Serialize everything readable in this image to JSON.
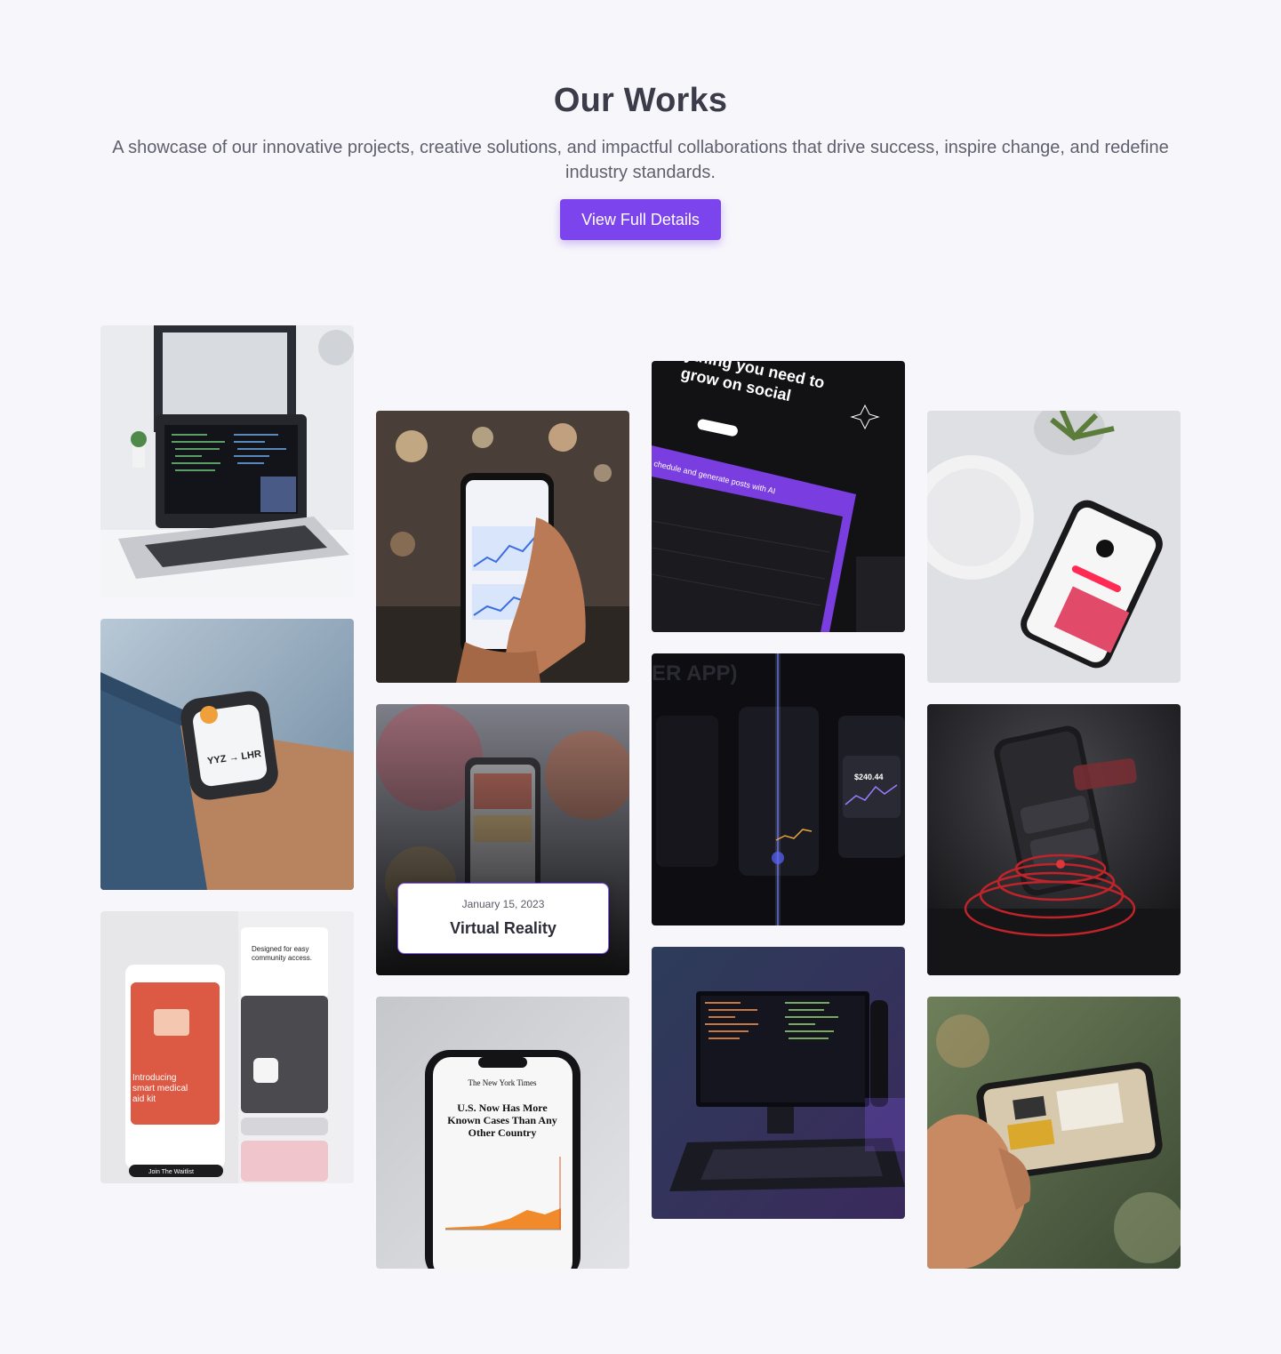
{
  "header": {
    "title": "Our Works",
    "subtitle": "A showcase of our innovative projects, creative solutions, and impactful collaborations that drive success, inspire change, and redefine industry standards.",
    "cta_label": "View Full Details"
  },
  "gallery": {
    "featured_caption": {
      "date": "January 15, 2023",
      "title": "Virtual Reality"
    },
    "tiles": [
      {
        "name": "laptop-code-desk"
      },
      {
        "name": "smartwatch-boarding-pass",
        "watch_text": "YYZ → LHR"
      },
      {
        "name": "medical-app-mockup",
        "headline": "Introducing smart medical aid kit",
        "side_heading": "Designed for easy community access.",
        "cta": "Join The Waitlist"
      },
      {
        "name": "phone-analytics-hand"
      },
      {
        "name": "virtual-reality-app"
      },
      {
        "name": "nyt-phone",
        "masthead": "The New York Times",
        "headline": "U.S. Now Has More Known Cases Than Any Other Country"
      },
      {
        "name": "social-ai-dashboard",
        "headline": "ything you need to grow on social",
        "strip_text": "chedule and generate posts with AI"
      },
      {
        "name": "crypto-app-screens",
        "balance": "$240.44"
      },
      {
        "name": "monitor-code-purple"
      },
      {
        "name": "tiktok-phone-table"
      },
      {
        "name": "finance-app-phone-red-cable"
      },
      {
        "name": "phone-room-photo"
      }
    ]
  }
}
